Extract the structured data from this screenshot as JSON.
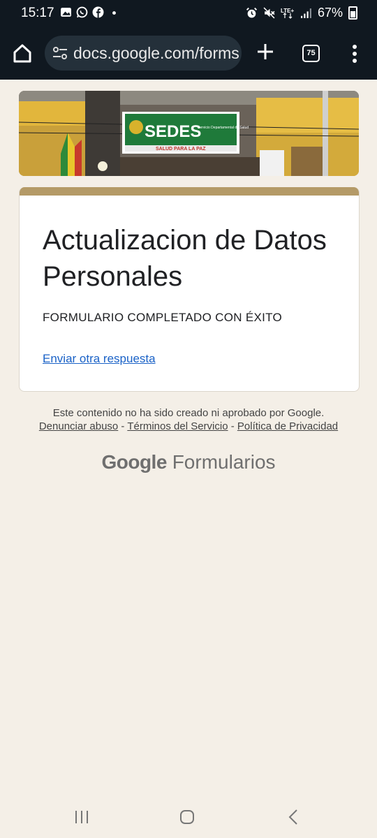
{
  "status_bar": {
    "time": "15:17",
    "network": "LTE+",
    "battery": "67%"
  },
  "browser": {
    "url": "docs.google.com/forms",
    "tab_count": "75"
  },
  "banner": {
    "sign_text": "SEDES",
    "sign_subtext": "Servicio Departamental de Salud",
    "slogan": "SALUD PARA LA PAZ"
  },
  "form": {
    "title": "Actualizacion de Datos Personales",
    "confirmation": "FORMULARIO COMPLETADO CON ÉXITO",
    "submit_another": "Enviar otra respuesta"
  },
  "footer": {
    "disclaimer": "Este contenido no ha sido creado ni aprobado por Google.",
    "links": {
      "report_abuse": "Denunciar abuso",
      "terms": "Términos del Servicio",
      "privacy": "Política de Privacidad",
      "separator": " - "
    },
    "brand_google": "Google",
    "brand_product": "Formularios"
  },
  "colors": {
    "page_background": "#f4efe7",
    "accent": "#b49a67",
    "link": "#1a62c7",
    "chrome": "#101820"
  }
}
